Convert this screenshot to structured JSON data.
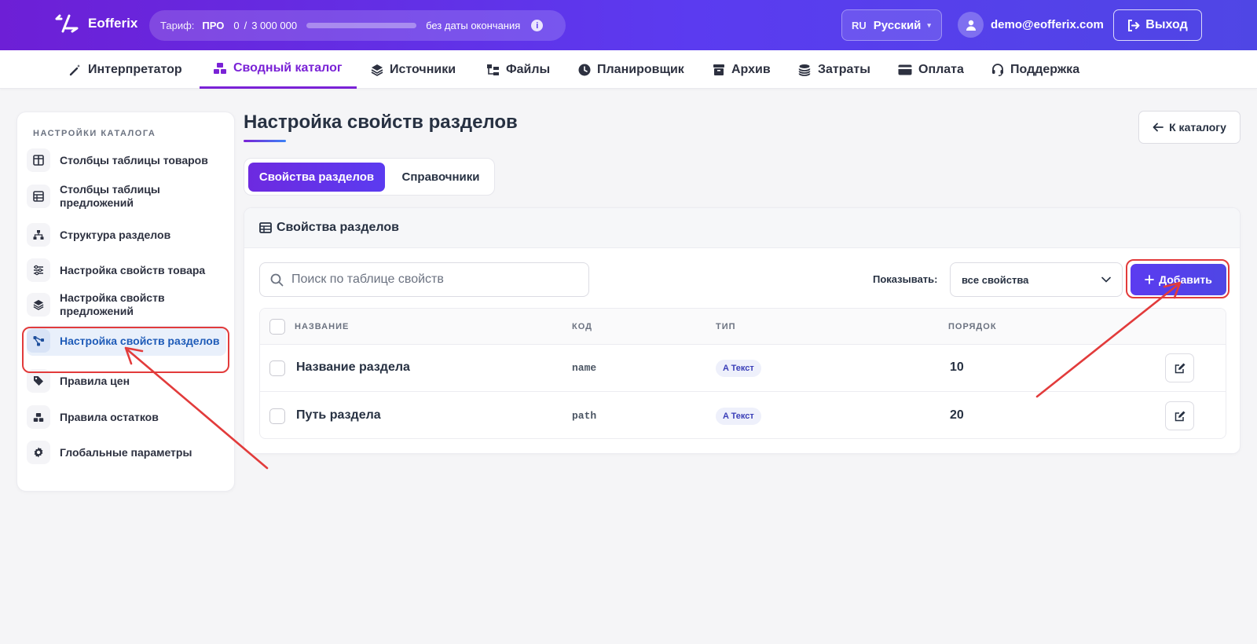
{
  "header": {
    "brand": "Eofferix",
    "tariff": {
      "label": "Тариф:",
      "plan": "ПРО",
      "used": "0",
      "separator": "/",
      "total": "3 000 000",
      "usage_fraction": 0.0,
      "expiry": "без даты окончания",
      "info_icon": "i"
    },
    "language": {
      "code": "RU",
      "name": "Русский",
      "caret": "▾"
    },
    "user_email": "demo@eofferix.com",
    "logout_label": "Выход"
  },
  "nav": {
    "items": [
      {
        "label": "Интерпретатор",
        "icon": "wand-icon"
      },
      {
        "label": "Сводный каталог",
        "icon": "boxes-icon",
        "active": true
      },
      {
        "label": "Источники",
        "icon": "layers-icon"
      },
      {
        "label": "Файлы",
        "icon": "folder-tree-icon"
      },
      {
        "label": "Планировщик",
        "icon": "clock-icon"
      },
      {
        "label": "Архив",
        "icon": "archive-icon"
      },
      {
        "label": "Затраты",
        "icon": "coins-icon"
      },
      {
        "label": "Оплата",
        "icon": "card-icon"
      },
      {
        "label": "Поддержка",
        "icon": "headset-icon"
      }
    ]
  },
  "sidebar": {
    "title": "НАСТРОЙКИ КАТАЛОГА",
    "items": [
      {
        "label": "Столбцы таблицы товаров",
        "icon": "columns-icon"
      },
      {
        "label": "Столбцы таблицы предложений",
        "icon": "table-icon"
      },
      {
        "label": "Структура разделов",
        "icon": "sitemap-icon"
      },
      {
        "label": "Настройка свойств товара",
        "icon": "sliders-icon"
      },
      {
        "label": "Настройка свойств предложений",
        "icon": "layers-icon"
      },
      {
        "label": "Настройка свойств разделов",
        "icon": "nodes-icon",
        "active": true
      },
      {
        "label": "Правила цен",
        "icon": "tags-icon"
      },
      {
        "label": "Правила остатков",
        "icon": "boxes-icon"
      },
      {
        "label": "Глобальные параметры",
        "icon": "gear-icon"
      }
    ]
  },
  "main": {
    "title": "Настройка свойств разделов",
    "back_label": "К каталогу",
    "tabs": [
      {
        "label": "Свойства разделов",
        "active": true
      },
      {
        "label": "Справочники"
      }
    ],
    "card": {
      "title": "Свойства разделов",
      "search_placeholder": "Поиск по таблице свойств",
      "show_label": "Показывать:",
      "filter_value": "все свойства",
      "add_label": "Добавить",
      "columns": [
        "НАЗВАНИЕ",
        "КОД",
        "ТИП",
        "ПОРЯДОК"
      ],
      "rows": [
        {
          "name": "Название раздела",
          "code": "name",
          "type": "A Текст",
          "order": "10"
        },
        {
          "name": "Путь раздела",
          "code": "path",
          "type": "A Текст",
          "order": "20"
        }
      ]
    }
  },
  "colors": {
    "accent": "#7a22d6",
    "primary": "#5b3bf0",
    "annotation": "#e23b3b"
  }
}
